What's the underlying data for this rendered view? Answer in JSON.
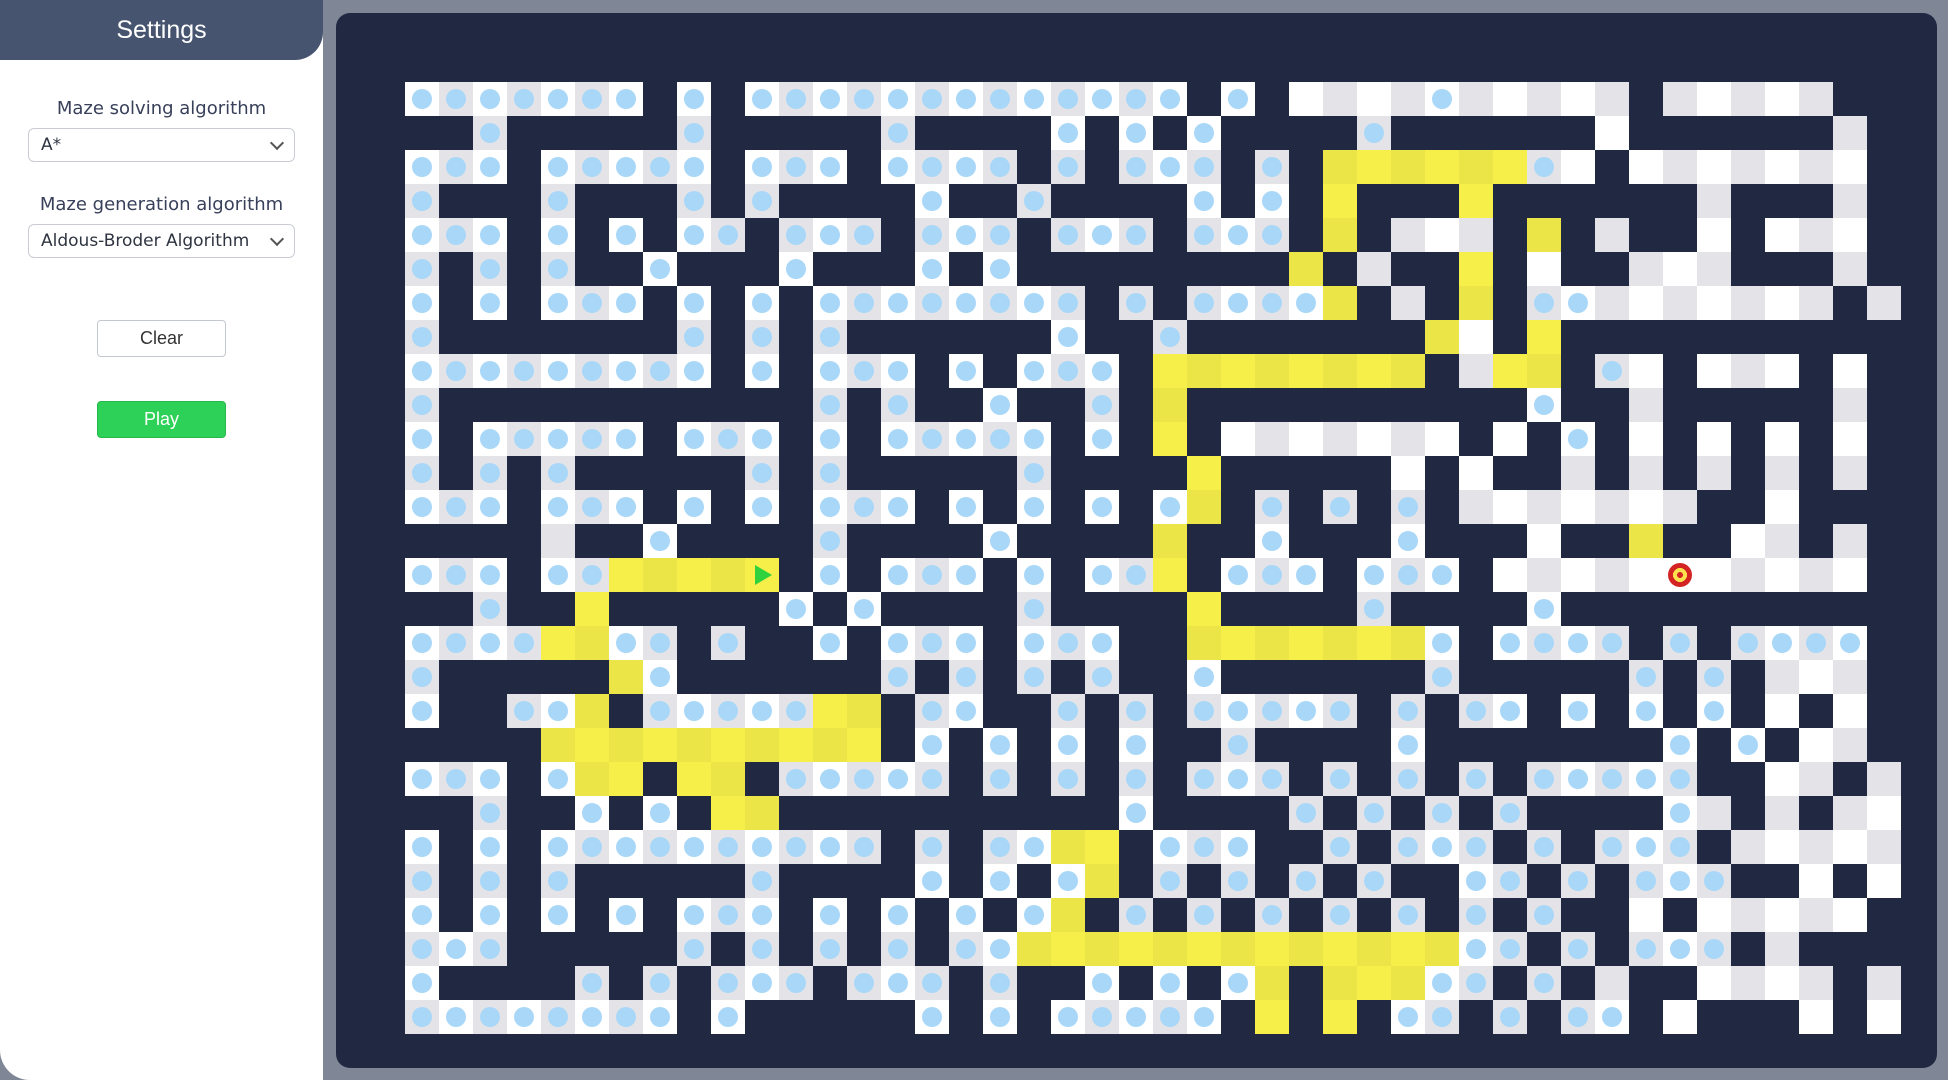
{
  "sidebar": {
    "title": "Settings",
    "solving_label": "Maze solving algorithm",
    "solving_value": "A*",
    "generation_label": "Maze generation algorithm",
    "generation_value": "Aldous-Broder Algorithm",
    "clear_label": "Clear",
    "play_label": "Play"
  },
  "maze": {
    "rows": 29,
    "cols": 45,
    "start": [
      14,
      10
    ],
    "target": [
      14,
      34
    ],
    "colors": {
      "wall": "#212942",
      "open": "#ffffff",
      "visited_dot": "#a9d7f8",
      "path": "#f6ef4a",
      "start": "#2fd13c",
      "target": "#d42323"
    },
    "grid": [
      "#############################################",
      "#vvvvvvv#v#vvvvvvvvvvvvv#v#....v.....#.....##",
      "###v#####v#####v####v#v#v####v######.######.#",
      "#vvv#vvvvv#vvv#vvvv#v#vvv#v#ppppppvo#.......#",
      "#v###v###v#v####v##v####v#v#p###p######.###.#",
      "#vvv#v#v#vv#vvv#vvv#vvv#vvv#p#...#p#.##.#...#",
      "#v#v#v##v###v###v#v########p#.##p#.##...###.#",
      "#v#v#vvv#v#v#vvvvvvvv#v#vvvvp#.#p#vv.......#.",
      "#v#######v#v#v######v##v#######p.#p##########",
      "#vvvvvvvvv#v#vvv#v#vvv#pppppppp#.pp#v.#...#.#",
      "#v###########v#v##v##v#p##########v##.#####.#",
      "#v#vvvvv#vvv#v#vvvvv#v#p#.......#.#v#.#.#.#.#",
      "#v#v#v#####v#v#####v####p#####.#.##.#.#.#.#.#",
      "#vvv#vvv#v#v#vvv#v#v#v#vp#v#v#v#.......##.###",
      "#####.##v####v####v####p##v###v###.##p##..#.#",
      "#vvv#vvpppps#v#vvv#v#vvp#vvv#vvv#.....t.....#",
      "###v##p#####v#v####v####p####v####v##########",
      "#vvvvppvv#v##v#vvv#vvv##pppppppv#vvvv#v#vvvv#",
      "#v#####pv######v#v#v#v##v######v#####v#v#...#",
      "#v##vvp#vvvvvpp#vv##v#v#vvvvv#v#vv#v#v#v#.#.#",
      "#####pppppppppp#v#v#v#v##v####v#######v#v#..#",
      "#vvv#vpp#pp#vvvvv#v#v#v#vvv#v#v#v#vvvvv##..#.",
      "###v##v#v#pp##########v####v#v#v#v####v.#.#..",
      "#v#v#vvvvvvvvvv#v#vvpp#vvv##v#vvv#v#vvv#.....",
      "#v#v#v#####v####v#v#vp#v#v#v#v##vv#v#vvv##.#.",
      "#v#v#v#v#vvv#v#v#v#vp#v#v#v#v#v#v#v##.#.....#",
      "#vvv#####v#v#v#v#vvpppppppppppppvv#v#vvv#.###",
      "#v####v#v#vvv#vvv#v##v#v#vp#pppvv#v#.##....#.",
      "#vvvvvvvv#v#####v#v#vvvvv#p#p#vv#v#vv#.###.#."
    ]
  }
}
